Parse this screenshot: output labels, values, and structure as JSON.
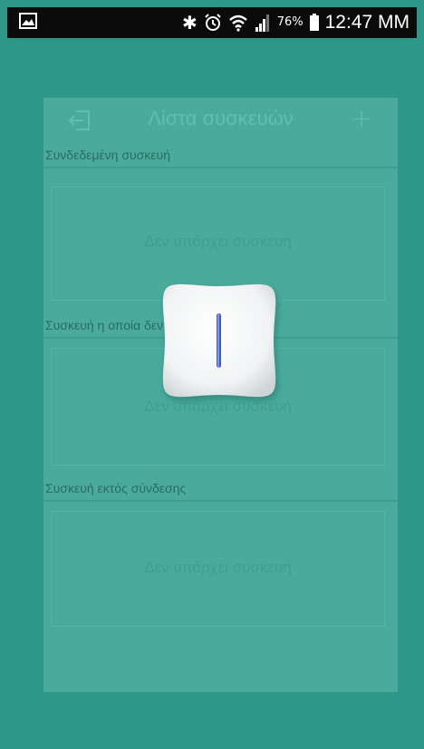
{
  "status_bar": {
    "icons": [
      "gallery-icon",
      "bluetooth-icon",
      "alarm-icon",
      "wifi-icon",
      "signal-icon",
      "battery-icon"
    ],
    "battery_percent": "76%",
    "time": "12:47 MM"
  },
  "header": {
    "title": "Λίστα συσκευών",
    "back_icon": "exit-icon",
    "add_icon": "plus-icon",
    "add_label": "+"
  },
  "sections": [
    {
      "label": "Συνδεδεμένη συσκευή",
      "empty_text": "Δεν υπάρχει συσκευή"
    },
    {
      "label": "Συσκευή η οποία δεν έχει οριστεί",
      "empty_text": "Δεν υπάρχει συσκευή"
    },
    {
      "label": "Συσκευή εκτός σύνδεσης",
      "empty_text": "Δεν υπάρχει συσκευή"
    }
  ],
  "loader": {
    "icon": "device-loading-icon"
  },
  "colors": {
    "background": "#2e9888",
    "card": "#4aab9c",
    "status_bar": "#0b0b0b",
    "loader_accent": "#3d5bd8"
  }
}
